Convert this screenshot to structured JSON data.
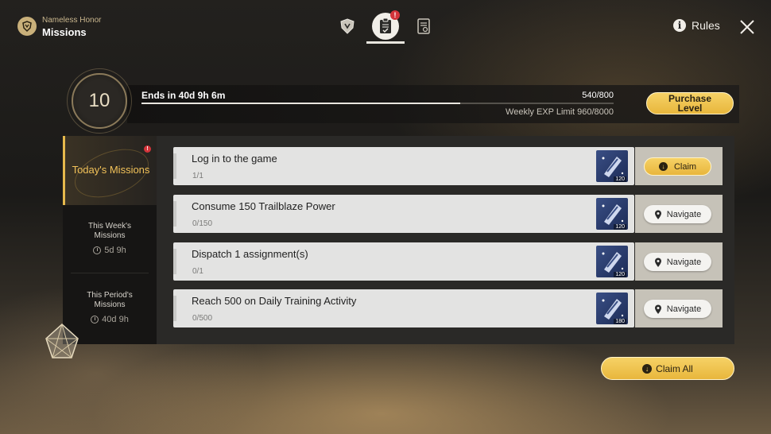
{
  "header": {
    "subtitle": "Nameless Honor",
    "title": "Missions",
    "tab_badge": "!",
    "rules_label": "Rules",
    "rules_icon_glyph": "i"
  },
  "level": {
    "value": "10",
    "ends_text": "Ends in 40d 9h 6m",
    "exp_text": "540/800",
    "exp_fraction": 0.675,
    "weekly_limit_text": "Weekly EXP Limit 960/8000",
    "purchase_button": "Purchase Level"
  },
  "sidebar": {
    "today": {
      "label": "Today's Missions",
      "badge": "!"
    },
    "week": {
      "label": "This Week's Missions",
      "time": "5d 9h"
    },
    "period": {
      "label": "This Period's Missions",
      "time": "40d 9h"
    }
  },
  "missions": [
    {
      "title": "Log in to the game",
      "progress": "1/1",
      "reward": "120",
      "action": "Claim"
    },
    {
      "title": "Consume 150 Trailblaze Power",
      "progress": "0/150",
      "reward": "120",
      "action": "Navigate"
    },
    {
      "title": "Dispatch 1 assignment(s)",
      "progress": "0/1",
      "reward": "120",
      "action": "Navigate"
    },
    {
      "title": "Reach 500 on Daily Training Activity",
      "progress": "0/500",
      "reward": "180",
      "action": "Navigate"
    }
  ],
  "claim_all_label": "Claim All",
  "icons": {
    "logo": "nameless-honor-emblem-icon",
    "tab1": "shield-emblem-icon",
    "tab2": "clipboard-check-icon",
    "tab3": "log-book-icon",
    "rules": "info-icon",
    "close": "close-icon",
    "claim": "download-arrow-icon",
    "navigate": "map-pin-icon",
    "reward": "exp-ticket-icon",
    "clock": "clock-icon"
  },
  "colors": {
    "accent_gold": "#e8b63c",
    "active_text": "#f2c259",
    "badge_red": "#d3343a"
  }
}
